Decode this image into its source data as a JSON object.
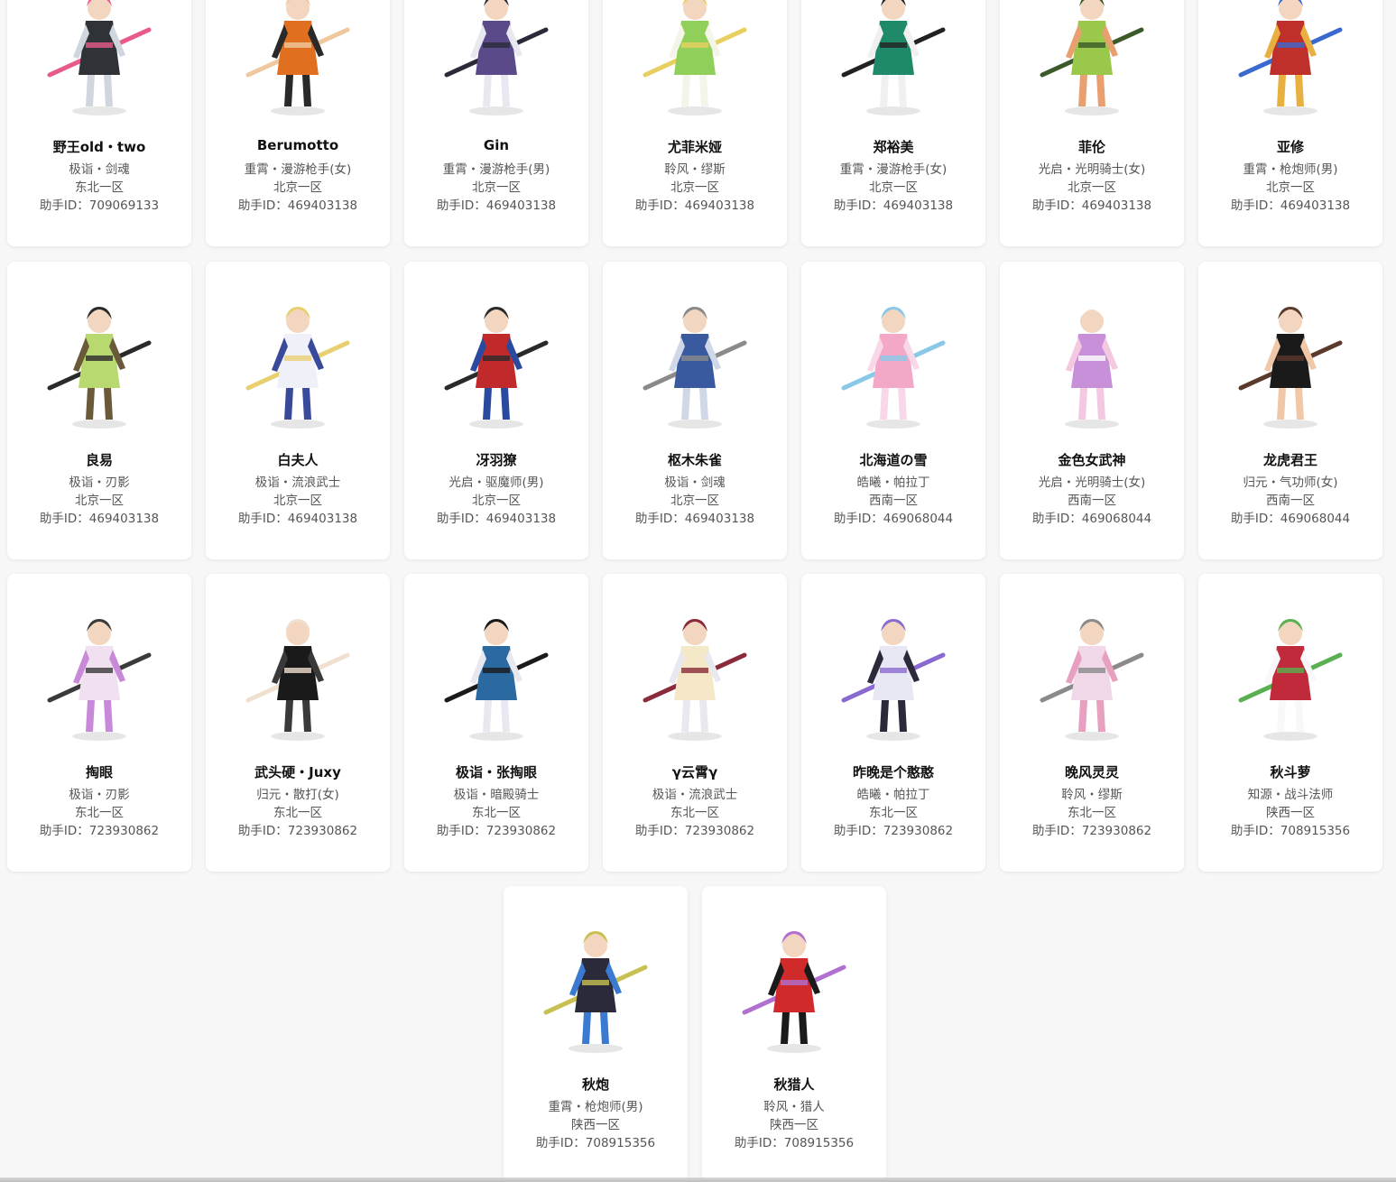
{
  "id_prefix": "助手ID：",
  "characters": [
    {
      "name": "野王old・two",
      "job": "极诣・剑魂",
      "server": "东北一区",
      "helper_id": "709069133",
      "palette": [
        "#2f3338",
        "#cfd6de",
        "#e85a8a"
      ]
    },
    {
      "name": "Berumotto",
      "job": "重霄・漫游枪手(女)",
      "server": "北京一区",
      "helper_id": "469403138",
      "palette": [
        "#e07020",
        "#2a2a2a",
        "#f0c8a0"
      ]
    },
    {
      "name": "Gin",
      "job": "重霄・漫游枪手(男)",
      "server": "北京一区",
      "helper_id": "469403138",
      "palette": [
        "#5a4a8a",
        "#e8e8f0",
        "#2a2a3a"
      ]
    },
    {
      "name": "尤菲米娅",
      "job": "聆风・缪斯",
      "server": "北京一区",
      "helper_id": "469403138",
      "palette": [
        "#8fcf5a",
        "#f4f4e8",
        "#e8d060"
      ]
    },
    {
      "name": "郑裕美",
      "job": "重霄・漫游枪手(女)",
      "server": "北京一区",
      "helper_id": "469403138",
      "palette": [
        "#1e8a6a",
        "#f0f0f0",
        "#222222"
      ]
    },
    {
      "name": "菲伦",
      "job": "光启・光明骑士(女)",
      "server": "北京一区",
      "helper_id": "469403138",
      "palette": [
        "#9ac84a",
        "#e8a070",
        "#3a5a2a"
      ]
    },
    {
      "name": "亚修",
      "job": "重霄・枪炮师(男)",
      "server": "北京一区",
      "helper_id": "469403138",
      "palette": [
        "#c0302a",
        "#e8b040",
        "#3a6ad0"
      ]
    },
    {
      "name": "良易",
      "job": "极诣・刃影",
      "server": "北京一区",
      "helper_id": "469403138",
      "palette": [
        "#b8d870",
        "#6a5a3a",
        "#2a2a2a"
      ]
    },
    {
      "name": "白夫人",
      "job": "极诣・流浪武士",
      "server": "北京一区",
      "helper_id": "469403138",
      "palette": [
        "#f0f0f8",
        "#3a4a9a",
        "#e8d070"
      ]
    },
    {
      "name": "冴羽獠",
      "job": "光启・驱魔师(男)",
      "server": "北京一区",
      "helper_id": "469403138",
      "palette": [
        "#c02a2a",
        "#2a4aa0",
        "#2a2a2a"
      ]
    },
    {
      "name": "枢木朱雀",
      "job": "极诣・剑魂",
      "server": "北京一区",
      "helper_id": "469403138",
      "palette": [
        "#3a5aa0",
        "#d0d8e8",
        "#8a8a8a"
      ]
    },
    {
      "name": "北海道の雪",
      "job": "皓曦・帕拉丁",
      "server": "西南一区",
      "helper_id": "469068044",
      "palette": [
        "#f4a8c8",
        "#f8d8e8",
        "#8ac8e8"
      ]
    },
    {
      "name": "金色女武神",
      "job": "光启・光明骑士(女)",
      "server": "西南一区",
      "helper_id": "469068044",
      "palette": [
        "#c890d8",
        "#f4c8e0",
        "#ffffff"
      ]
    },
    {
      "name": "龙虎君王",
      "job": "归元・气功师(女)",
      "server": "西南一区",
      "helper_id": "469068044",
      "palette": [
        "#1a1a1a",
        "#f0c8a8",
        "#5a3a2a"
      ]
    },
    {
      "name": "掏眼",
      "job": "极诣・刃影",
      "server": "东北一区",
      "helper_id": "723930862",
      "palette": [
        "#f0e0f0",
        "#c88ad8",
        "#3a3a3a"
      ]
    },
    {
      "name": "武头硬・Juxy",
      "job": "归元・散打(女)",
      "server": "东北一区",
      "helper_id": "723930862",
      "palette": [
        "#1a1a1a",
        "#3a3a3a",
        "#f0e0d0"
      ]
    },
    {
      "name": "极诣・张掏眼",
      "job": "极诣・暗殿骑士",
      "server": "东北一区",
      "helper_id": "723930862",
      "palette": [
        "#2a6aa0",
        "#e8e8f0",
        "#1a1a1a"
      ]
    },
    {
      "name": "γ云霄γ",
      "job": "极诣・流浪武士",
      "server": "东北一区",
      "helper_id": "723930862",
      "palette": [
        "#f4e8c8",
        "#e8e8f0",
        "#8a2a3a"
      ]
    },
    {
      "name": "昨晚是个憨憨",
      "job": "皓曦・帕拉丁",
      "server": "东北一区",
      "helper_id": "723930862",
      "palette": [
        "#e8e8f4",
        "#2a2a3a",
        "#8a6ad0"
      ]
    },
    {
      "name": "晚风灵灵",
      "job": "聆风・缪斯",
      "server": "东北一区",
      "helper_id": "723930862",
      "palette": [
        "#f0d8e8",
        "#e8a0c0",
        "#8a8a8a"
      ]
    },
    {
      "name": "秋斗萝",
      "job": "知源・战斗法师",
      "server": "陕西一区",
      "helper_id": "708915356",
      "palette": [
        "#c02a3a",
        "#f8f8f8",
        "#5ab050"
      ]
    },
    {
      "name": "秋炮",
      "job": "重霄・枪炮师(男)",
      "server": "陕西一区",
      "helper_id": "708915356",
      "palette": [
        "#2a2a3a",
        "#3a7ad0",
        "#c8c050"
      ]
    },
    {
      "name": "秋猎人",
      "job": "聆风・猎人",
      "server": "陕西一区",
      "helper_id": "708915356",
      "palette": [
        "#d02a2a",
        "#1a1a1a",
        "#b070d0"
      ]
    }
  ]
}
